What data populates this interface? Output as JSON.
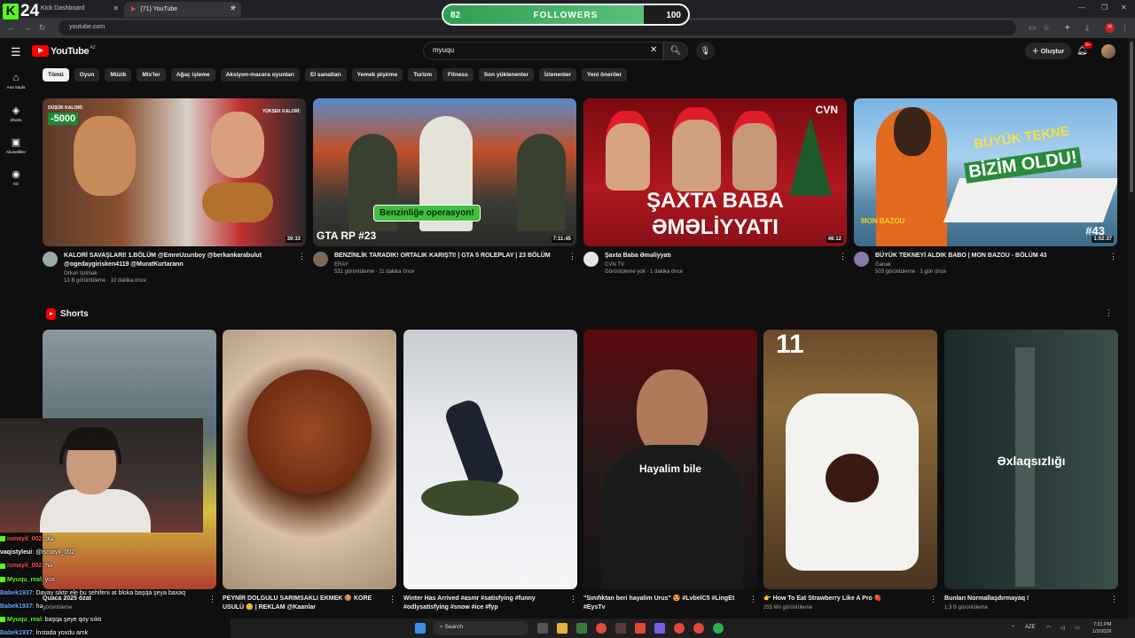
{
  "browser": {
    "tabs": [
      {
        "label": "Kick Dashboard"
      },
      {
        "label": "(71) YouTube"
      }
    ],
    "url": "youtube.com"
  },
  "overlay": {
    "brand": "24",
    "followers": {
      "current": "82",
      "label": "FOLLOWERS",
      "goal": "100",
      "progress": 0.82
    }
  },
  "youtube": {
    "logo_text": "YouTube",
    "logo_country": "AZ",
    "search_query": "myuqu",
    "create_label": "Oluştur",
    "notification_count": "9+",
    "profile_initial": "H",
    "chips": [
      "Tümü",
      "Oyun",
      "Müzik",
      "Mix'ler",
      "Ağaç işleme",
      "Aksiyon-macera oyunları",
      "El sanatları",
      "Yemek pişirme",
      "Turizm",
      "Fitness",
      "Son yüklenenler",
      "İzlenenler",
      "Yeni öneriler"
    ],
    "rail": [
      {
        "icon": "home-icon",
        "label": "Ana Sayfa"
      },
      {
        "icon": "shorts-icon",
        "label": "Shorts"
      },
      {
        "icon": "subscriptions-icon",
        "label": "Abonelikler"
      },
      {
        "icon": "you-icon",
        "label": "Siz"
      }
    ],
    "videos": [
      {
        "title": "KALORİ SAVAŞLARI! 1.BÖLÜM @EmreUzunboy @berkankarabulut @ogedaygirisken4119 @MuratKurtarann",
        "channel": "Orkun Işıtmak",
        "stats": "13 B görüntüleme · 10 dakika önce",
        "duration": "39:33",
        "thumb_labels": [
          "DÜŞÜK KALORİ:",
          "-5000",
          "YÜKSEK KALORİ:"
        ]
      },
      {
        "title": "BENZİNLİK TARADIK! ORTALIK KARIŞTI! | GTA 5 ROLEPLAY | 23 BÖLÜM",
        "channel": "ERAY",
        "stats": "531 görüntüleme · 11 dakika önce",
        "duration": "7:11:45",
        "thumb_labels": [
          "Benzinliğe operasyon!",
          "GTA RP #23"
        ]
      },
      {
        "title": "Şaxta Baba Əməliyyatı",
        "channel": "CVN TV",
        "stats": "Görüntüleme yok · 1 dakika önce",
        "duration": "46:12",
        "thumb_labels": [
          "ŞAXTA BABA",
          "ƏMƏLİYYATI",
          "CVN"
        ]
      },
      {
        "title": "BÜYÜK TEKNEYİ ALDIK BABO | MON BAZOU - BÖLÜM 43",
        "channel": "Ganak",
        "stats": "503 görüntüleme · 1 gün önce",
        "duration": "1:02:37",
        "thumb_labels": [
          "BÜYÜK TEKNE",
          "BİZİM OLDU!",
          "#43",
          "MON BAZOU"
        ]
      }
    ],
    "shorts_title": "Shorts",
    "shorts": [
      {
        "title": "Quaca 2025 özat",
        "stats": "görüntüleme",
        "overlay": ""
      },
      {
        "title": "PEYNİR DOLGULU SARIMSAKLI EKMEK 🍪 KORE USULÜ 😊 | REKLAM @Kaanlar",
        "stats": "",
        "overlay": ""
      },
      {
        "title": "Winter Has Arrived #asmr #satisfying #funny #odlysatisfying #snow #ice #fyp",
        "stats": "",
        "overlay": ""
      },
      {
        "title": "\"Sınıfıktan beri hayalim Urus\" 😍 #LvbelC5 #LingEt #EysTv",
        "stats": "",
        "overlay": "Hayalim bile"
      },
      {
        "title": "👉 How To Eat Strawberry Like A Pro 🍓",
        "stats": "255 Mn görüntüleme",
        "overlay": "11"
      },
      {
        "title": "Bunları Normallaşdırmayaq !",
        "stats": "1,3 B görüntüleme",
        "overlay": "Əxlaqsızlığı"
      }
    ]
  },
  "chat": [
    {
      "user": "ismayil_002",
      "msg": ": blə",
      "color": "#ff4b4b",
      "badge": true
    },
    {
      "user": "vaqistyleui",
      "msg": ": @ismayil_002",
      "color": "#ffffff",
      "badge": false
    },
    {
      "user": "ismayil_002",
      "msg": ": hə",
      "color": "#ff4b4b",
      "badge": true
    },
    {
      "user": "Myuqu_real",
      "msg": ": yox",
      "color": "#53fc18",
      "badge": true
    },
    {
      "user": "Babek1937",
      "msg": ": Davay siktir ele bu sehifeni at bloka başqa şeya baxaq",
      "color": "#6fa8ff",
      "badge": false
    },
    {
      "user": "Babek1937",
      "msg": ": hə",
      "color": "#6fa8ff",
      "badge": false
    },
    {
      "user": "Myuqu_real",
      "msg": ": başqa şeye qoy sıktı",
      "color": "#53fc18",
      "badge": true
    },
    {
      "user": "Babek1937",
      "msg": ": İnstada yoxdu amk",
      "color": "#6fa8ff",
      "badge": false
    }
  ],
  "taskbar": {
    "search_label": "Search",
    "tray_lang": "AZE",
    "time": "7:31 PM",
    "date": "1/2/2026"
  },
  "colors": {
    "accent_red": "#ff0000",
    "kick_green": "#53fc18",
    "bg": "#0f0f0f"
  }
}
